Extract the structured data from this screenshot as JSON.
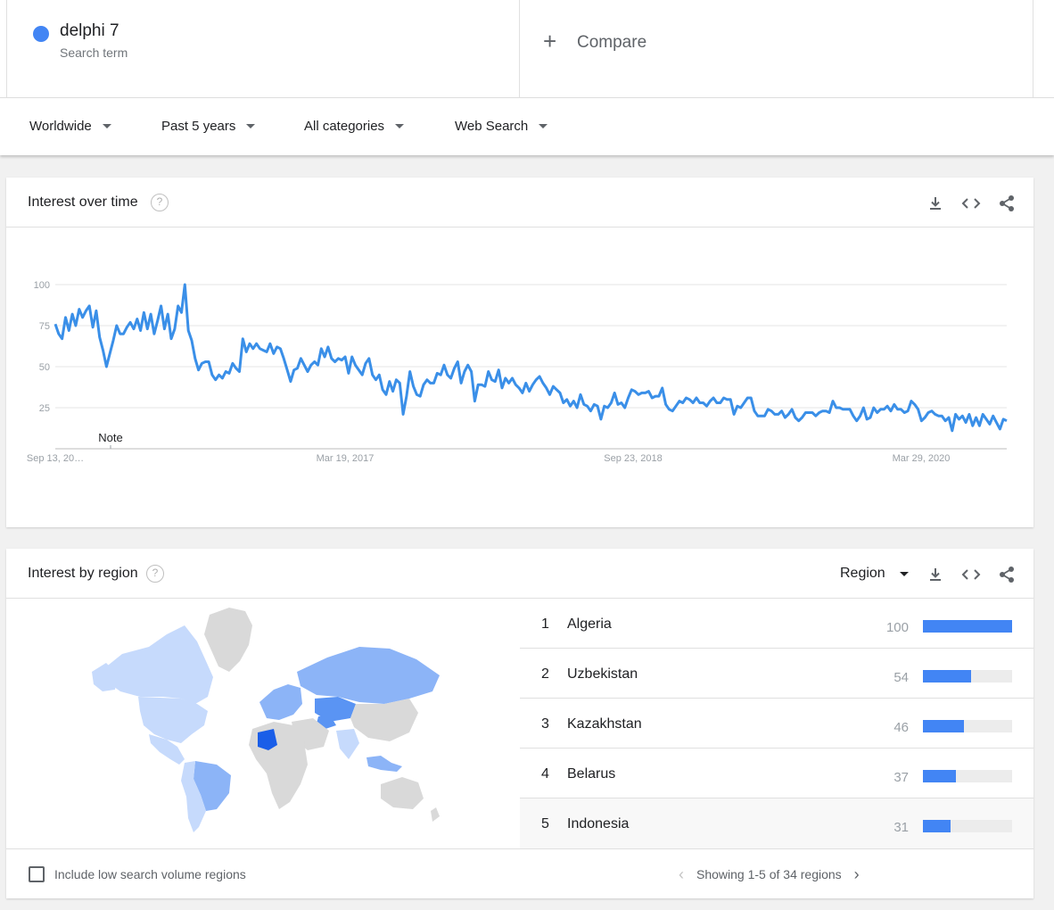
{
  "search_term": {
    "name": "delphi 7",
    "subtitle": "Search term",
    "color": "#4285f4"
  },
  "compare": {
    "label": "Compare",
    "icon": "plus-icon"
  },
  "filters": {
    "geo": "Worldwide",
    "time": "Past 5 years",
    "category": "All categories",
    "property": "Web Search"
  },
  "interest_over_time": {
    "title": "Interest over time",
    "note_label": "Note",
    "icons": [
      "download-icon",
      "embed-icon",
      "share-icon"
    ]
  },
  "chart_data": {
    "type": "line",
    "ylim": [
      0,
      100
    ],
    "y_ticks": [
      "25",
      "50",
      "75",
      "100"
    ],
    "x_tick_labels": [
      "Sep 13, 20…",
      "Mar 19, 2017",
      "Sep 23, 2018",
      "Mar 29, 2020"
    ],
    "grid": true,
    "series": [
      {
        "color": "#3a8fe8",
        "values": [
          76,
          70,
          67,
          80,
          72,
          82,
          75,
          85,
          80,
          84,
          87,
          74,
          84,
          68,
          60,
          50,
          58,
          66,
          75,
          70,
          70,
          74,
          77,
          73,
          79,
          72,
          83,
          73,
          82,
          70,
          78,
          87,
          73,
          82,
          67,
          73,
          87,
          83,
          100,
          72,
          66,
          55,
          48,
          52,
          53,
          53,
          45,
          42,
          45,
          43,
          47,
          46,
          52,
          49,
          47,
          67,
          59,
          64,
          61,
          64,
          61,
          60,
          59,
          64,
          58,
          62,
          61,
          55,
          48,
          41,
          48,
          49,
          55,
          51,
          47,
          51,
          53,
          51,
          61,
          56,
          62,
          55,
          53,
          55,
          54,
          56,
          46,
          56,
          51,
          48,
          45,
          52,
          55,
          45,
          42,
          45,
          36,
          33,
          41,
          35,
          42,
          40,
          21,
          32,
          47,
          38,
          33,
          32,
          39,
          42,
          40,
          40,
          46,
          45,
          51,
          45,
          43,
          49,
          53,
          40,
          47,
          51,
          47,
          29,
          39,
          39,
          38,
          47,
          42,
          41,
          48,
          37,
          43,
          40,
          43,
          39,
          37,
          34,
          40,
          35,
          39,
          42,
          44,
          40,
          37,
          33,
          38,
          36,
          34,
          28,
          30,
          26,
          29,
          25,
          33,
          27,
          26,
          23,
          27,
          26,
          18,
          26,
          25,
          28,
          34,
          27,
          28,
          25,
          31,
          36,
          35,
          33,
          34,
          34,
          35,
          31,
          32,
          32,
          37,
          27,
          24,
          23,
          26,
          29,
          28,
          31,
          30,
          28,
          31,
          28,
          28,
          26,
          29,
          31,
          28,
          28,
          31,
          30,
          30,
          21,
          26,
          25,
          28,
          31,
          31,
          23,
          20,
          20,
          20,
          24,
          23,
          21,
          21,
          23,
          19,
          21,
          24,
          19,
          17,
          19,
          22,
          22,
          22,
          20,
          22,
          23,
          23,
          22,
          29,
          25,
          25,
          24,
          24,
          24,
          20,
          17,
          20,
          25,
          18,
          19,
          25,
          22,
          24,
          24,
          26,
          23,
          27,
          24,
          24,
          22,
          23,
          29,
          27,
          24,
          17,
          19,
          22,
          23,
          21,
          20,
          20,
          17,
          19,
          11,
          21,
          18,
          20,
          16,
          21,
          14,
          19,
          14,
          21,
          18,
          15,
          20,
          16,
          12,
          18,
          17
        ]
      }
    ]
  },
  "interest_by_region": {
    "title": "Interest by region",
    "resolution": "Region",
    "icons": [
      "download-icon",
      "embed-icon",
      "share-icon"
    ],
    "rows": [
      {
        "rank": "1",
        "name": "Algeria",
        "value": 100
      },
      {
        "rank": "2",
        "name": "Uzbekistan",
        "value": 54
      },
      {
        "rank": "3",
        "name": "Kazakhstan",
        "value": 46
      },
      {
        "rank": "4",
        "name": "Belarus",
        "value": 37
      },
      {
        "rank": "5",
        "name": "Indonesia",
        "value": 31
      }
    ],
    "low_volume_label": "Include low search volume regions",
    "pager_text": "Showing 1-5 of 34 regions",
    "map_colors": {
      "grey": "#d9d9d9",
      "low": "#c6dafc",
      "mid": "#8cb4f7",
      "high": "#5a94f3",
      "top": "#1a5ee8"
    }
  }
}
